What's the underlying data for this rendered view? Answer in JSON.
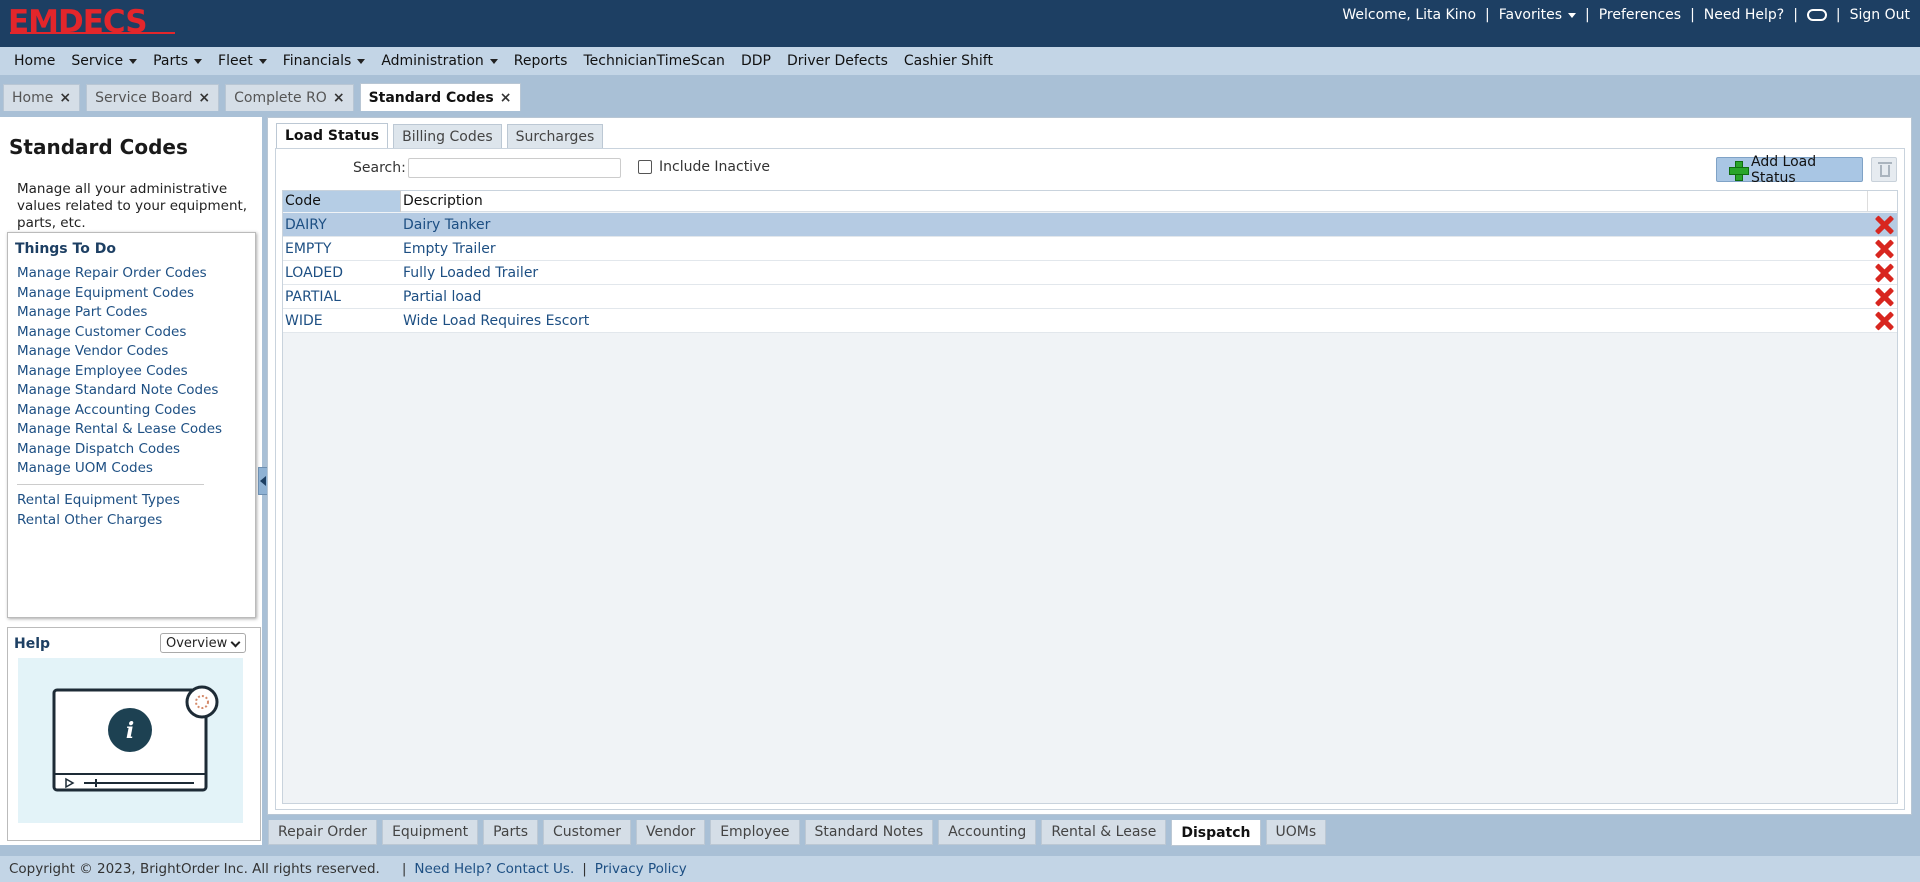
{
  "brand": {
    "logo_text": "EMDECS",
    "logo_color": "#e3262b",
    "topbar_color": "#1d3f63"
  },
  "topbar": {
    "welcome": "Welcome, Lita Kino",
    "favorites": "Favorites",
    "preferences": "Preferences",
    "help": "Need Help?",
    "signout": "Sign Out"
  },
  "menu": {
    "items": [
      {
        "label": "Home",
        "dropdown": false
      },
      {
        "label": "Service",
        "dropdown": true
      },
      {
        "label": "Parts",
        "dropdown": true
      },
      {
        "label": "Fleet",
        "dropdown": true
      },
      {
        "label": "Financials",
        "dropdown": true
      },
      {
        "label": "Administration",
        "dropdown": true
      },
      {
        "label": "Reports",
        "dropdown": false
      },
      {
        "label": "TechnicianTimeScan",
        "dropdown": false
      },
      {
        "label": "DDP",
        "dropdown": false
      },
      {
        "label": "Driver Defects",
        "dropdown": false
      },
      {
        "label": "Cashier Shift",
        "dropdown": false
      }
    ]
  },
  "page_tabs": [
    {
      "label": "Home",
      "active": false
    },
    {
      "label": "Service Board",
      "active": false
    },
    {
      "label": "Complete RO",
      "active": false
    },
    {
      "label": "Standard Codes",
      "active": true
    }
  ],
  "left": {
    "title": "Standard Codes",
    "description": "Manage all your administrative values related to your equipment, parts, etc.",
    "things_title": "Things To Do",
    "links": [
      "Manage Repair Order Codes",
      "Manage Equipment Codes",
      "Manage Part Codes",
      "Manage Customer Codes",
      "Manage Vendor Codes",
      "Manage Employee Codes",
      "Manage Standard Note Codes",
      "Manage Accounting Codes",
      "Manage Rental & Lease Codes",
      "Manage Dispatch Codes",
      "Manage UOM Codes"
    ],
    "extra_links": [
      "Rental Equipment Types",
      "Rental Other Charges"
    ],
    "help_title": "Help",
    "help_select": "Overview"
  },
  "sub_tabs": [
    {
      "label": "Load Status",
      "active": true
    },
    {
      "label": "Billing Codes",
      "active": false
    },
    {
      "label": "Surcharges",
      "active": false
    }
  ],
  "toolbar": {
    "search_label": "Search:",
    "search_value": "",
    "include_inactive_label": "Include Inactive",
    "include_inactive_checked": false,
    "add_label": "Add Load Status"
  },
  "grid": {
    "columns": [
      "Code",
      "Description"
    ],
    "rows": [
      {
        "code": "DAIRY",
        "description": "Dairy Tanker",
        "selected": true
      },
      {
        "code": "EMPTY",
        "description": "Empty Trailer",
        "selected": false
      },
      {
        "code": "LOADED",
        "description": "Fully Loaded Trailer",
        "selected": false
      },
      {
        "code": "PARTIAL",
        "description": "Partial load",
        "selected": false
      },
      {
        "code": "WIDE",
        "description": "Wide Load Requires Escort",
        "selected": false
      }
    ]
  },
  "bottom_tabs": [
    {
      "label": "Repair Order",
      "active": false
    },
    {
      "label": "Equipment",
      "active": false
    },
    {
      "label": "Parts",
      "active": false
    },
    {
      "label": "Customer",
      "active": false
    },
    {
      "label": "Vendor",
      "active": false
    },
    {
      "label": "Employee",
      "active": false
    },
    {
      "label": "Standard Notes",
      "active": false
    },
    {
      "label": "Accounting",
      "active": false
    },
    {
      "label": "Rental & Lease",
      "active": false
    },
    {
      "label": "Dispatch",
      "active": true
    },
    {
      "label": "UOMs",
      "active": false
    }
  ],
  "footer": {
    "copyright": "Copyright © 2023, BrightOrder Inc. All rights reserved.",
    "help_link": "Need Help? Contact Us.",
    "privacy_link": "Privacy Policy"
  }
}
